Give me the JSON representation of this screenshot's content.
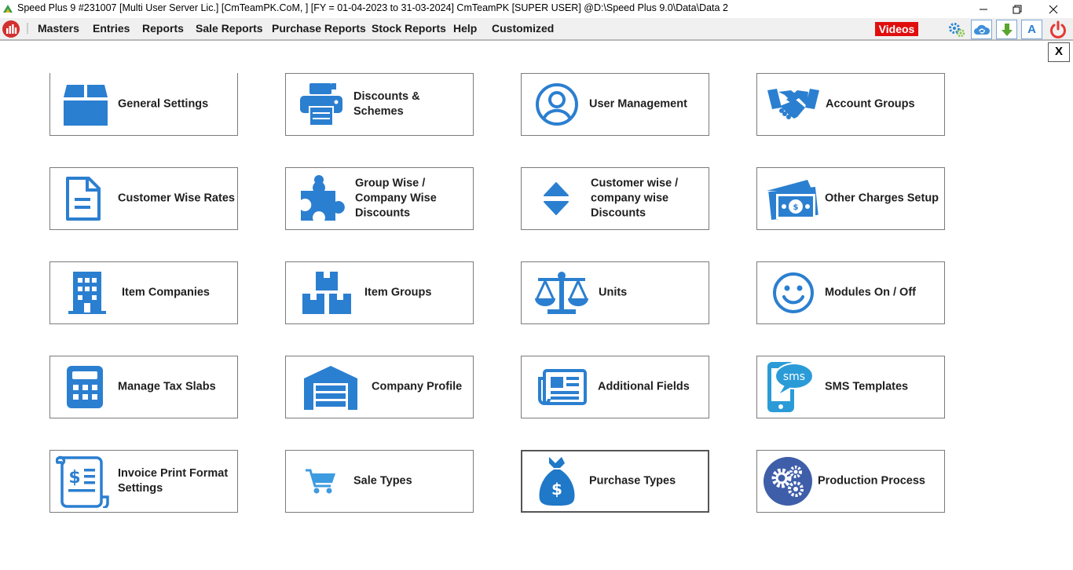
{
  "window": {
    "title": "Speed Plus 9 #231007  [Multi User Server Lic.]  [CmTeamPK.CoM, ] [FY = 01-04-2023 to 31-03-2024] CmTeamPK [SUPER USER]  @D:\\Speed Plus 9.0\\Data\\Data 2"
  },
  "menu": {
    "items": [
      "Masters",
      "Entries",
      "Reports",
      "Sale Reports",
      "Purchase Reports",
      "Stock Reports",
      "Help",
      "Customized"
    ],
    "videos_label": "Videos",
    "font_button_label": "A"
  },
  "panel": {
    "close_label": "X"
  },
  "tiles": [
    {
      "lines": [
        "General Settings"
      ],
      "icon": "box-icon"
    },
    {
      "lines": [
        "Discounts & Schemes"
      ],
      "icon": "printer-icon"
    },
    {
      "lines": [
        "User Management"
      ],
      "icon": "user-circle-icon"
    },
    {
      "lines": [
        "Account Groups"
      ],
      "icon": "handshake-icon"
    },
    {
      "lines": [
        "Customer Wise Rates"
      ],
      "icon": "document-icon"
    },
    {
      "lines": [
        "Group Wise /",
        "Company Wise",
        "Discounts"
      ],
      "icon": "puzzle-icon"
    },
    {
      "lines": [
        "Customer wise /",
        "company wise",
        "Discounts"
      ],
      "icon": "sort-arrows-icon"
    },
    {
      "lines": [
        "Other Charges Setup"
      ],
      "icon": "money-icon"
    },
    {
      "lines": [
        "Item Companies"
      ],
      "icon": "building-icon"
    },
    {
      "lines": [
        "Item Groups"
      ],
      "icon": "boxes-icon"
    },
    {
      "lines": [
        "Units"
      ],
      "icon": "scale-icon"
    },
    {
      "lines": [
        "Modules On / Off"
      ],
      "icon": "smiley-icon"
    },
    {
      "lines": [
        "Manage Tax Slabs"
      ],
      "icon": "calculator-icon"
    },
    {
      "lines": [
        "Company Profile"
      ],
      "icon": "warehouse-icon"
    },
    {
      "lines": [
        "Additional Fields"
      ],
      "icon": "newspaper-icon"
    },
    {
      "lines": [
        "SMS Templates"
      ],
      "icon": "sms-phone-icon"
    },
    {
      "lines": [
        "Invoice Print Format",
        "Settings"
      ],
      "icon": "receipt-icon"
    },
    {
      "lines": [
        "Sale Types"
      ],
      "icon": "cart-icon"
    },
    {
      "lines": [
        "Purchase Types"
      ],
      "icon": "money-bag-icon"
    },
    {
      "lines": [
        "Production Process"
      ],
      "icon": "gears-icon"
    }
  ],
  "colors": {
    "accent_blue": "#2b7fd0",
    "videos_red": "#e10e0e",
    "power_red": "#e53935",
    "logo_red": "#d32f2f",
    "gears_blue": "#3f5ea9"
  }
}
